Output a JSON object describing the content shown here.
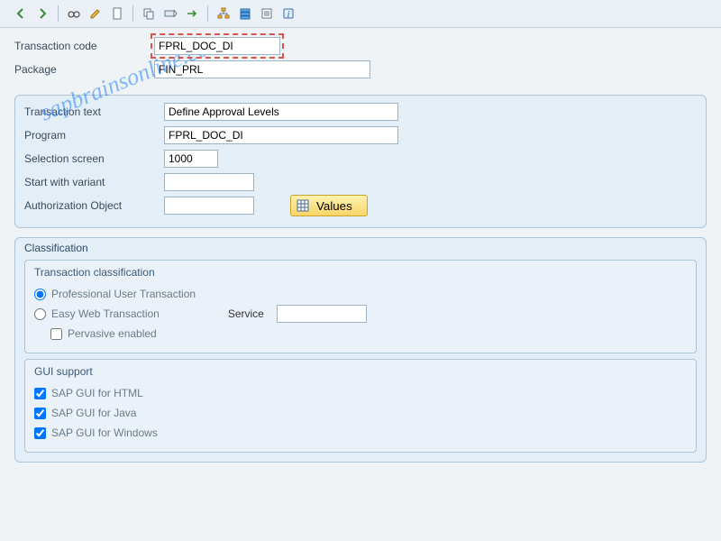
{
  "header": {
    "transaction_code_label": "Transaction code",
    "transaction_code_value": "FPRL_DOC_DI",
    "package_label": "Package",
    "package_value": "FIN_PRL"
  },
  "details": {
    "transaction_text_label": "Transaction text",
    "transaction_text_value": "Define Approval Levels",
    "program_label": "Program",
    "program_value": "FPRL_DOC_DI",
    "selection_screen_label": "Selection screen",
    "selection_screen_value": "1000",
    "start_variant_label": "Start with variant",
    "start_variant_value": "",
    "auth_object_label": "Authorization Object",
    "auth_object_value": "",
    "values_button": "Values"
  },
  "classification": {
    "group_title": "Classification",
    "trans_class_title": "Transaction classification",
    "radio_prof": "Professional User Transaction",
    "radio_easy": "Easy Web Transaction",
    "service_label": "Service",
    "service_value": "",
    "chk_pervasive": "Pervasive enabled",
    "gui_title": "GUI support",
    "gui_html": "SAP GUI for HTML",
    "gui_java": "SAP GUI for Java",
    "gui_win": "SAP GUI for Windows"
  },
  "watermark": "sapbrainsonline.com"
}
